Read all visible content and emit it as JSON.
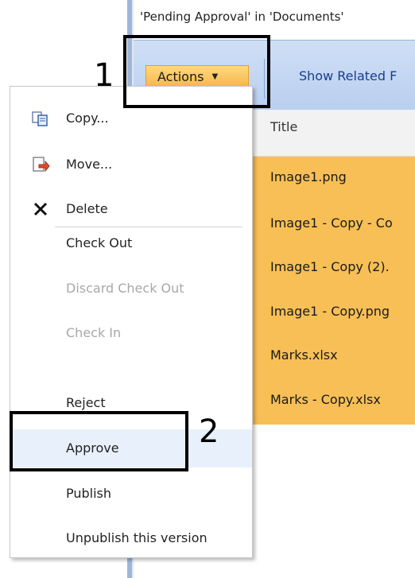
{
  "breadcrumb": "'Pending Approval' in 'Documents'",
  "toolbar": {
    "actions_label": "Actions",
    "show_related_label": "Show Related F"
  },
  "list": {
    "column_title": "Title",
    "rows": [
      "Image1.png",
      "Image1 - Copy - Co",
      "Image1 - Copy (2).",
      "Image1 - Copy.png",
      "Marks.xlsx",
      "Marks - Copy.xlsx"
    ]
  },
  "menu": {
    "items": [
      {
        "label": "Copy...",
        "icon": "copy-icon",
        "disabled": false
      },
      {
        "label": "Move...",
        "icon": "move-icon",
        "disabled": false
      },
      {
        "label": "Delete",
        "icon": "delete-icon",
        "disabled": false
      },
      {
        "label": "Check Out",
        "disabled": false
      },
      {
        "label": "Discard Check Out",
        "disabled": true
      },
      {
        "label": "Check In",
        "disabled": true
      },
      {
        "label": "Reject",
        "disabled": false
      },
      {
        "label": "Approve",
        "disabled": false,
        "highlighted": true
      },
      {
        "label": "Publish",
        "disabled": false
      },
      {
        "label": "Unpublish this version",
        "disabled": false
      }
    ]
  },
  "annotations": [
    "1",
    "2"
  ],
  "colors": {
    "toolbar": "#c5d8f2",
    "actions_button": "#f7c260",
    "selected_rows": "#f7bf55",
    "menu_highlight": "#e8f1fb"
  }
}
